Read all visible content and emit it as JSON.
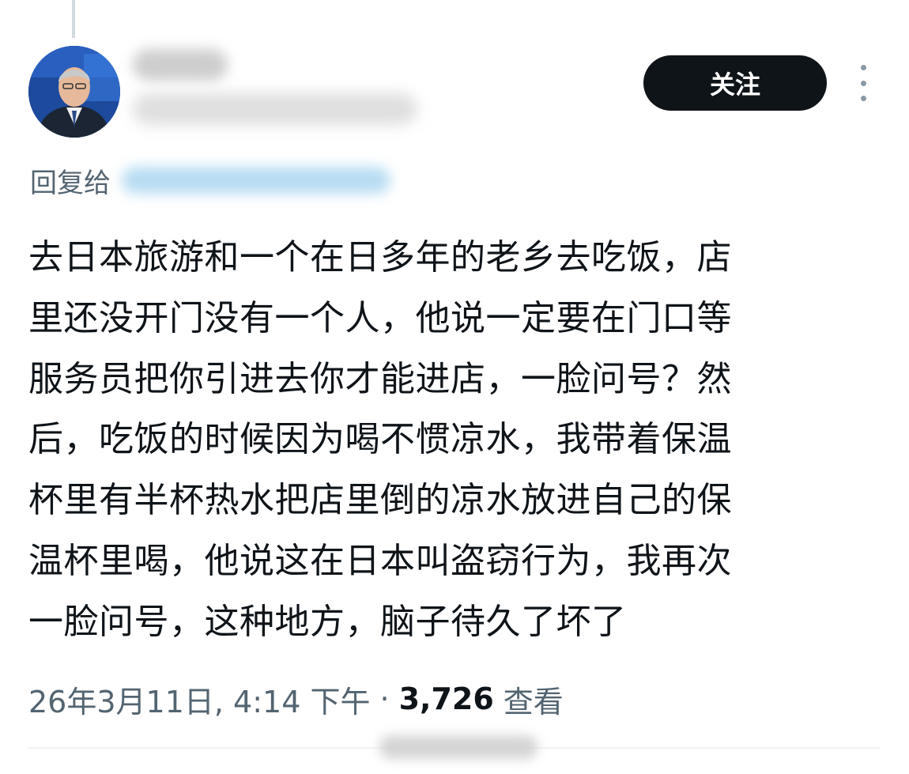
{
  "follow_label": "关注",
  "reply_prefix": "回复给",
  "tweet_lines": [
    "去日本旅游和一个在日多年的老乡去吃饭，店",
    "里还没开门没有一个人，他说一定要在门口等",
    "服务员把你引进去你才能进店，一脸问号？然",
    "后，吃饭的时候因为喝不惯凉水，我带着保温",
    "杯里有半杯热水把店里倒的凉水放进自己的保",
    "温杯里喝，他说这在日本叫盗窃行为，我再次",
    "一脸问号，这种地方，脑子待久了坏了"
  ],
  "timestamp": "26年3月11日, 4:14 下午",
  "separator": "·",
  "views_count": "3,726",
  "views_label": "查看",
  "icons": {
    "more": "more-vertical-icon",
    "avatar": "avatar"
  },
  "colors": {
    "follow_bg": "#0f1419",
    "secondary_text": "#536471",
    "primary_text": "#0f1419"
  }
}
